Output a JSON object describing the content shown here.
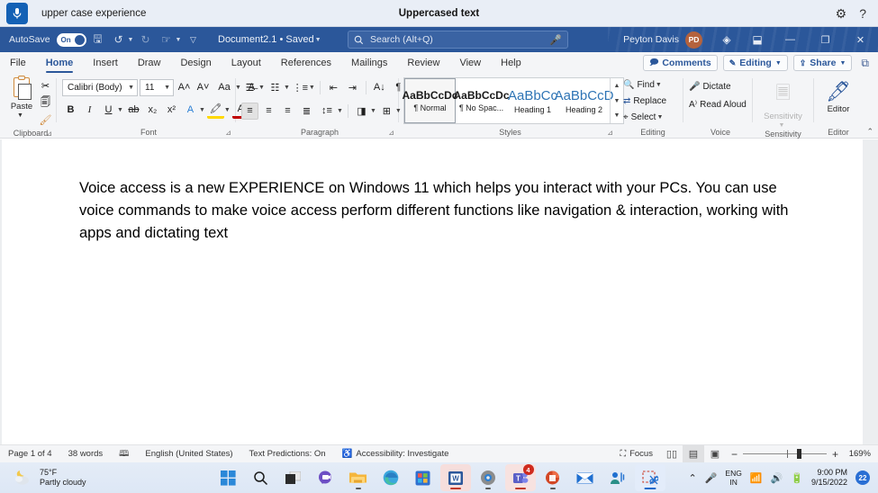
{
  "voice_access": {
    "mic_icon": "microphone-icon",
    "phrase": "upper case experience",
    "title": "Uppercased text",
    "settings_icon": "gear-icon",
    "help_icon": "question-mark-icon"
  },
  "title_bar": {
    "autosave_label": "AutoSave",
    "autosave_state": "On",
    "save_icon": "save-icon",
    "undo_icon": "undo-icon",
    "redo_icon": "redo-icon",
    "touch_icon": "touch-mode-icon",
    "customize_icon": "customize-qat-icon",
    "document_name": "Document2.1  •  Saved",
    "document_caret": "chevron-down-icon",
    "search_icon": "search-icon",
    "search_placeholder": "Search (Alt+Q)",
    "search_mic_icon": "microphone-icon",
    "user_name": "Peyton Davis",
    "avatar_initials": "PD",
    "diamond_icon": "copilot-diamond-icon",
    "ribbon_display_icon": "ribbon-display-options-icon",
    "minimize_icon": "minimize-icon",
    "restore_icon": "restore-icon",
    "close_icon": "close-icon",
    "accent": "#2b579a"
  },
  "ribbon_tabs": {
    "items": [
      {
        "label": "File",
        "active": false
      },
      {
        "label": "Home",
        "active": true
      },
      {
        "label": "Insert",
        "active": false
      },
      {
        "label": "Draw",
        "active": false
      },
      {
        "label": "Design",
        "active": false
      },
      {
        "label": "Layout",
        "active": false
      },
      {
        "label": "References",
        "active": false
      },
      {
        "label": "Mailings",
        "active": false
      },
      {
        "label": "Review",
        "active": false
      },
      {
        "label": "View",
        "active": false
      },
      {
        "label": "Help",
        "active": false
      }
    ],
    "comments": "Comments",
    "editing": "Editing",
    "share": "Share",
    "present_icon": "present-live-icon"
  },
  "ribbon": {
    "clipboard": {
      "label": "Clipboard",
      "paste": "Paste",
      "cut_icon": "scissors-icon",
      "copy_icon": "copy-icon",
      "format_painter_icon": "format-painter-icon",
      "dialog_icon": "dialog-launcher-icon"
    },
    "font": {
      "label": "Font",
      "family": "Calibri (Body)",
      "size": "11",
      "grow_icon": "increase-font-size-icon",
      "shrink_icon": "decrease-font-size-icon",
      "change_case_icon": "change-case-icon",
      "clear_format_icon": "clear-formatting-icon",
      "bold": "B",
      "italic": "I",
      "underline": "U",
      "strikethrough_icon": "strikethrough-icon",
      "subscript_icon": "subscript-icon",
      "superscript_icon": "superscript-icon",
      "text_effects_icon": "text-effects-icon",
      "highlight_icon": "text-highlight-icon",
      "font_color_icon": "font-color-icon",
      "dialog_icon": "dialog-launcher-icon"
    },
    "paragraph": {
      "label": "Paragraph",
      "bullets_icon": "bullet-list-icon",
      "numbering_icon": "numbered-list-icon",
      "multilevel_icon": "multilevel-list-icon",
      "decrease_indent_icon": "decrease-indent-icon",
      "increase_indent_icon": "increase-indent-icon",
      "sort_icon": "sort-icon",
      "show_marks_icon": "show-formatting-marks-icon",
      "align_left_icon": "align-left-icon",
      "align_center_icon": "align-center-icon",
      "align_right_icon": "align-right-icon",
      "justify_icon": "justify-icon",
      "line_spacing_icon": "line-spacing-icon",
      "shading_icon": "shading-icon",
      "borders_icon": "borders-icon",
      "dialog_icon": "dialog-launcher-icon"
    },
    "styles": {
      "label": "Styles",
      "items": [
        {
          "preview": "AaBbCcDc",
          "name": "¶ Normal",
          "selected": true,
          "heading": false
        },
        {
          "preview": "AaBbCcDc",
          "name": "¶ No Spac...",
          "selected": false,
          "heading": false
        },
        {
          "preview": "AaBbCc",
          "name": "Heading 1",
          "selected": false,
          "heading": true
        },
        {
          "preview": "AaBbCcD",
          "name": "Heading 2",
          "selected": false,
          "heading": true
        }
      ],
      "scroll_up_icon": "scroll-up-icon",
      "scroll_down_icon": "scroll-down-icon",
      "more_icon": "more-styles-icon",
      "dialog_icon": "dialog-launcher-icon"
    },
    "editing": {
      "label": "Editing",
      "find": "Find",
      "replace": "Replace",
      "select": "Select",
      "find_icon": "find-icon",
      "replace_icon": "replace-icon",
      "select_icon": "select-cursor-icon"
    },
    "voice": {
      "label": "Voice",
      "dictate": "Dictate",
      "read_aloud": "Read Aloud",
      "dictate_icon": "microphone-icon",
      "read_aloud_icon": "read-aloud-icon"
    },
    "sensitivity": {
      "label": "Sensitivity",
      "button": "Sensitivity",
      "icon": "sensitivity-icon",
      "disabled": true
    },
    "editor": {
      "label": "Editor",
      "button": "Editor",
      "icon": "editor-pen-icon"
    },
    "collapse_icon": "collapse-ribbon-icon"
  },
  "document": {
    "paragraph": "Voice access is a new EXPERIENCE on Windows 11 which helps you interact with your PCs. You can use voice commands to make voice access perform different functions like navigation & interaction, working with apps and dictating text"
  },
  "status_bar": {
    "page": "Page 1 of 4",
    "words": "38 words",
    "proofing_icon": "proofing-errors-icon",
    "language": "English (United States)",
    "text_predictions": "Text Predictions: On",
    "accessibility_icon": "accessibility-icon",
    "accessibility": "Accessibility: Investigate",
    "focus": "Focus",
    "focus_icon": "focus-mode-icon",
    "read_mode_icon": "read-mode-icon",
    "print_layout_icon": "print-layout-icon",
    "web_layout_icon": "web-layout-icon",
    "zoom_out_icon": "zoom-out-icon",
    "zoom_in_icon": "zoom-in-icon",
    "zoom_level": "169%"
  },
  "taskbar": {
    "weather_temp": "75°F",
    "weather_desc": "Partly cloudy",
    "weather_icon": "partly-cloudy-night-icon",
    "apps": [
      {
        "name": "start-button",
        "icon": "windows-logo-icon"
      },
      {
        "name": "search-button",
        "icon": "search-icon"
      },
      {
        "name": "task-view-button",
        "icon": "task-view-icon"
      },
      {
        "name": "chat-button",
        "icon": "chat-teams-icon"
      },
      {
        "name": "file-explorer-button",
        "icon": "file-explorer-icon"
      },
      {
        "name": "edge-button",
        "icon": "edge-browser-icon"
      },
      {
        "name": "microsoft-store-button",
        "icon": "microsoft-store-icon"
      },
      {
        "name": "word-button",
        "icon": "word-icon"
      },
      {
        "name": "settings-button",
        "icon": "settings-gear-icon"
      },
      {
        "name": "teams-button",
        "icon": "teams-icon",
        "badge": "4"
      },
      {
        "name": "powerpoint-button",
        "icon": "powerpoint-icon"
      },
      {
        "name": "mail-button",
        "icon": "mail-icon"
      },
      {
        "name": "voice-access-button",
        "icon": "voice-access-icon"
      },
      {
        "name": "snipping-tool-button",
        "icon": "snipping-tool-icon"
      }
    ],
    "tray_chevron_icon": "show-hidden-icons-icon",
    "tray_mic_icon": "microphone-icon",
    "language_line1": "ENG",
    "language_line2": "IN",
    "wifi_icon": "wifi-icon",
    "volume_icon": "volume-icon",
    "battery_icon": "battery-icon",
    "time": "9:00 PM",
    "date": "9/15/2022",
    "notification_count": "22"
  }
}
